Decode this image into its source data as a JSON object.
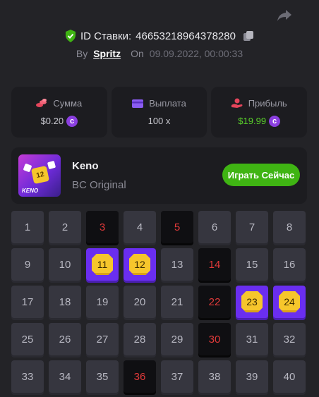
{
  "header": {
    "id_label": "ID Ставки:",
    "id_value": "46653218964378280",
    "by_label": "By",
    "user": "Spritz",
    "on_label": "On",
    "date": "09.09.2022, 00:00:33"
  },
  "stats": [
    {
      "label": "Сумма",
      "value": "$0.20",
      "icon": "coins-stack-icon",
      "coin": true,
      "color": "#c9c9d0"
    },
    {
      "label": "Выплата",
      "value": "100 x",
      "icon": "wallet-icon",
      "coin": false,
      "color": "#c9c9d0"
    },
    {
      "label": "Прибыль",
      "value": "$19.99",
      "icon": "profit-hand-icon",
      "coin": true,
      "color": "#5ad32a"
    }
  ],
  "game": {
    "name": "Keno",
    "subtitle": "BC Original",
    "play_label": "Играть Сейчас",
    "thumb_ball": "12",
    "thumb_logo": "KENO"
  },
  "grid": {
    "columns": 8,
    "numbers": [
      1,
      2,
      3,
      4,
      5,
      6,
      7,
      8,
      9,
      10,
      11,
      12,
      13,
      14,
      15,
      16,
      17,
      18,
      19,
      20,
      21,
      22,
      23,
      24,
      25,
      26,
      27,
      28,
      29,
      30,
      31,
      32,
      33,
      34,
      35,
      36,
      37,
      38,
      39,
      40
    ],
    "miss": [
      3,
      5,
      14,
      22,
      30,
      36
    ],
    "hit": [
      11,
      12,
      23,
      24
    ]
  },
  "colors": {
    "background": "#232327",
    "accent_purple": "#6a2ef0",
    "play_green": "#3fb413",
    "miss_red": "#e23a3a",
    "gem_yellow": "#f6c62c"
  }
}
